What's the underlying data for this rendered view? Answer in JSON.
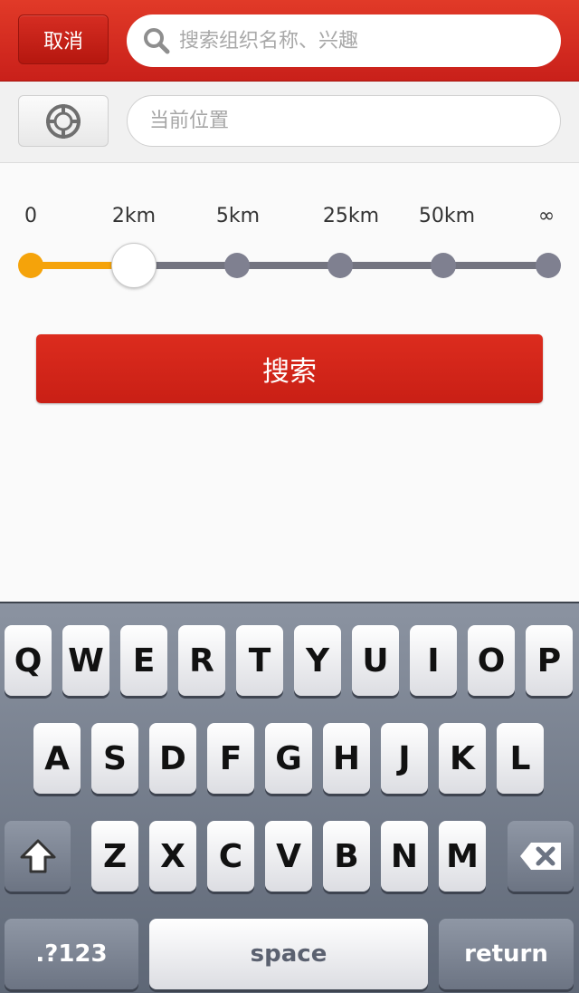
{
  "header": {
    "cancel_label": "取消",
    "search_placeholder": "搜索组织名称、兴趣",
    "search_icon": "search-icon"
  },
  "location": {
    "locate_icon": "crosshair-icon",
    "placeholder": "当前位置"
  },
  "distance_slider": {
    "ticks": [
      "0",
      "2km",
      "5km",
      "25km",
      "50km",
      "∞"
    ],
    "selected_index": 1,
    "fill_color": "#f5a30a",
    "track_color": "#737480"
  },
  "search_button_label": "搜索",
  "keyboard": {
    "row1": [
      "Q",
      "W",
      "E",
      "R",
      "T",
      "Y",
      "U",
      "I",
      "O",
      "P"
    ],
    "row2": [
      "A",
      "S",
      "D",
      "F",
      "G",
      "H",
      "J",
      "K",
      "L"
    ],
    "row3": [
      "Z",
      "X",
      "C",
      "V",
      "B",
      "N",
      "M"
    ],
    "shift_icon": "shift-arrow-icon",
    "backspace_icon": "backspace-icon",
    "numbers_label": ".?123",
    "space_label": "space",
    "return_label": "return"
  },
  "colors": {
    "brand_red": "#d42a1e",
    "accent_orange": "#f5a30a"
  }
}
